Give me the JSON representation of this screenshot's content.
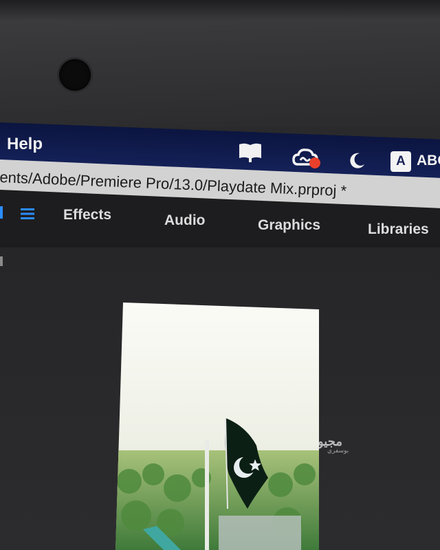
{
  "menubar": {
    "help_label": "Help",
    "tray": {
      "icons": [
        "book-icon",
        "creative-cloud-icon",
        "moon-icon",
        "keyboard-language-icon"
      ],
      "language_key": "A",
      "language_code": "ABC"
    },
    "colors": {
      "bar": "#16245e",
      "notification_dot": "#e8402a"
    }
  },
  "pathbar": {
    "project_path": "ents/Adobe/Premiere Pro/13.0/Playdate Mix.prproj *"
  },
  "workspaces": {
    "menu_icon": "hamburger-icon",
    "tabs": [
      {
        "label": "Effects"
      },
      {
        "label": "Audio"
      },
      {
        "label": "Graphics"
      },
      {
        "label": "Libraries"
      }
    ],
    "accent_color": "#2a8cff"
  },
  "program_monitor": {
    "frame_content": "flag-video-frame",
    "watermark": "مجيو",
    "watermark_sub": "بوسفري"
  }
}
